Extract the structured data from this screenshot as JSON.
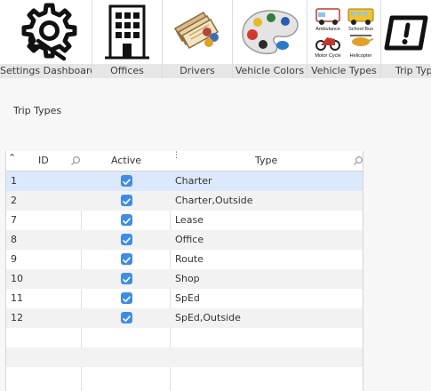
{
  "toolbar": {
    "items": [
      {
        "label": "Settings Dashboard",
        "icon": "gear-wrench-icon"
      },
      {
        "label": "Offices",
        "icon": "office-building-icon"
      },
      {
        "label": "Drivers",
        "icon": "drivers-icon"
      },
      {
        "label": "Vehicle Colors",
        "icon": "color-palette-icon"
      },
      {
        "label": "Vehicle Types",
        "icon": "vehicle-types-icon"
      },
      {
        "label": "Trip Typ",
        "icon": "trip-types-icon"
      }
    ],
    "vehicle_type_captions": [
      "Ambulance",
      "School Bus",
      "Motor Cycle",
      "Helicopter"
    ]
  },
  "section": {
    "title": "Trip Types"
  },
  "grid": {
    "columns": [
      "ID",
      "Active",
      "Type"
    ],
    "rows": [
      {
        "id": "1",
        "active": true,
        "type": "Charter"
      },
      {
        "id": "2",
        "active": true,
        "type": "Charter,Outside"
      },
      {
        "id": "7",
        "active": true,
        "type": "Lease"
      },
      {
        "id": "8",
        "active": true,
        "type": "Office"
      },
      {
        "id": "9",
        "active": true,
        "type": "Route"
      },
      {
        "id": "10",
        "active": true,
        "type": "Shop"
      },
      {
        "id": "11",
        "active": true,
        "type": "SpEd"
      },
      {
        "id": "12",
        "active": true,
        "type": "SpEd,Outside"
      }
    ],
    "selected_row": 0
  },
  "colors": {
    "accent": "#3f8de3",
    "selection": "#dce8fb"
  }
}
